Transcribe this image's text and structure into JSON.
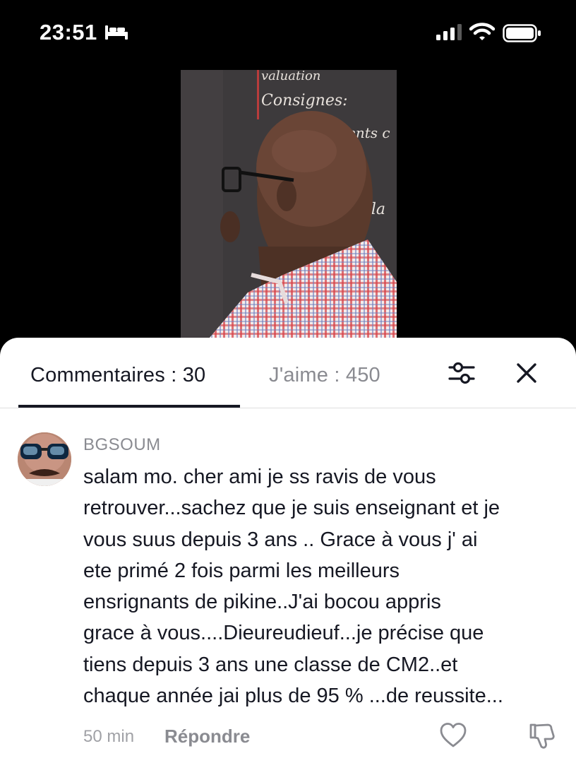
{
  "status_bar": {
    "time": "23:51",
    "icons": [
      "bed-icon",
      "signal-icon",
      "wifi-icon",
      "battery-icon"
    ]
  },
  "video": {
    "chalkboard_text": [
      "valuation",
      "Consignes:",
      "ents c",
      "t la"
    ],
    "colors": {
      "chalkboard": "#3d3a3c",
      "skin": "#5a3a2c",
      "shirt_red": "#d6454a",
      "shirt_blue": "#6d7fbf"
    }
  },
  "comments_panel": {
    "tabs": {
      "comments_label": "Commentaires : 30",
      "likes_label": "J'aime : 450"
    },
    "icons": [
      "filter-icon",
      "close-icon"
    ],
    "comment": {
      "username": "BGSOUM",
      "lines": [
        "salam mo. cher ami je ss ravis de vous",
        "retrouver...sachez que je suis enseignant et je",
        "vous suus depuis 3 ans .. Grace à vous j' ai",
        "ete primé 2 fois parmi les meilleurs",
        "ensrignants de pikine..J'ai bocou appris",
        "grace à vous....Dieureudieuf...je précise que",
        "tiens depuis 3 ans une classe de CM2..et",
        "chaque année jai plus de 95 % ...de reussite..."
      ],
      "time": "50 min",
      "reply_label": "Répondre",
      "actions": [
        "heart-icon",
        "dislike-icon"
      ]
    }
  },
  "colors": {
    "text_primary": "#161823",
    "text_secondary": "#8a8b91",
    "divider": "#dedede",
    "background_top": "#000000",
    "sheet": "#ffffff"
  }
}
